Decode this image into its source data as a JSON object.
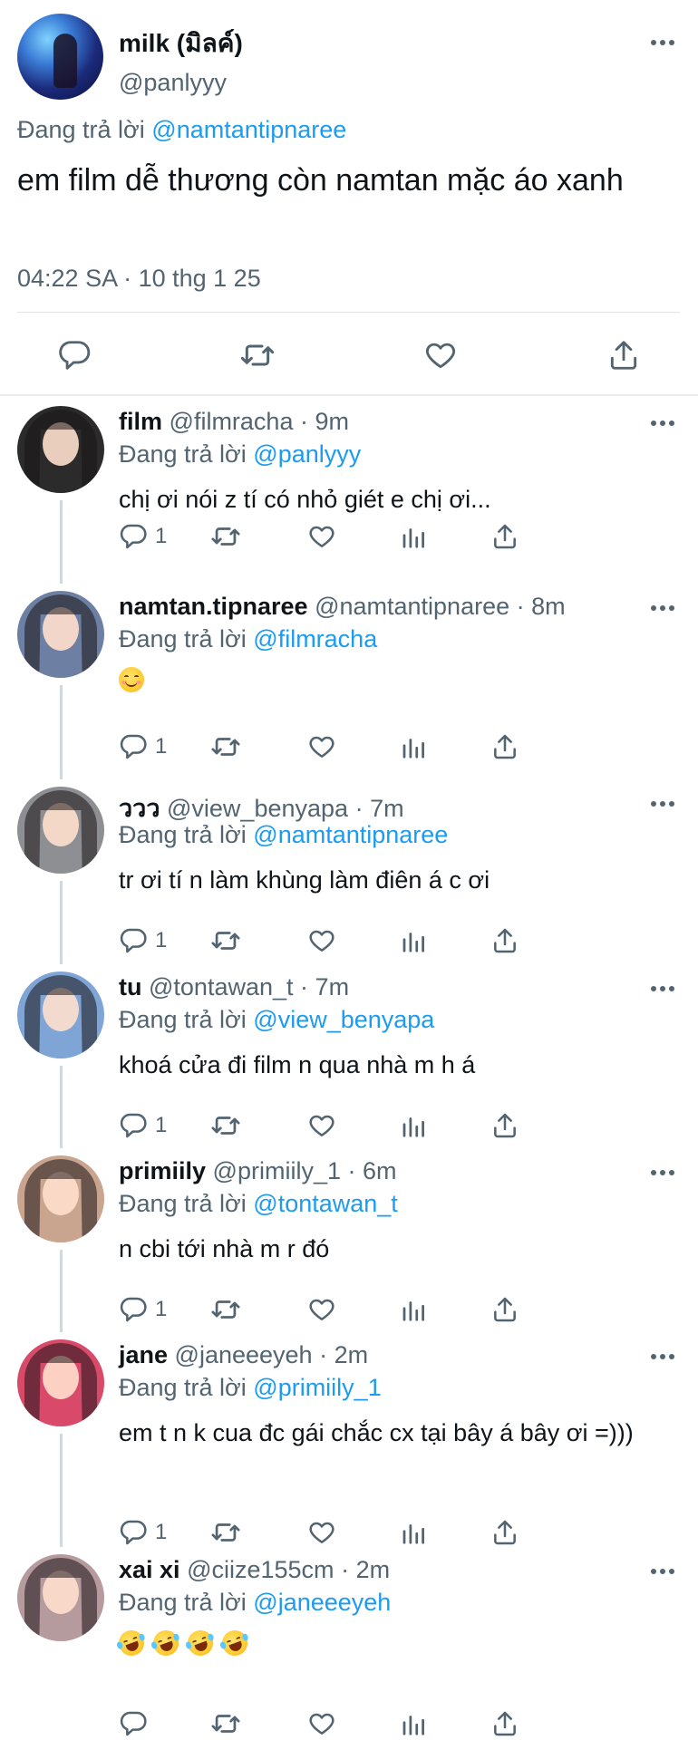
{
  "main": {
    "name": "milk (มิลค์)",
    "handle": "@panlyyy",
    "reply_prefix": "Đang trả lời",
    "reply_to": "@namtantipnaree",
    "text": "em film dễ thương còn namtan mặc áo xanh",
    "timestamp": "04:22 SA · 10 thg 1 25"
  },
  "replies": [
    {
      "name": "film",
      "handle": "@filmracha",
      "time": "9m",
      "reply_prefix": "Đang trả lời",
      "reply_to": "@panlyyy",
      "text": "chị ơi nói z tí có nhỏ giét e chị ơi...",
      "reply_count": "1",
      "avatar_color": "#2b2b2b"
    },
    {
      "name": "namtan.tipnaree",
      "handle": "@namtantipnaree",
      "time": "8m",
      "reply_prefix": "Đang trả lời",
      "reply_to": "@filmracha",
      "text": "",
      "emoji": "smiling-face-with-smiling-eyes",
      "reply_count": "1",
      "avatar_color": "#6d7fa3"
    },
    {
      "name": "ววว",
      "handle": "@view_benyapa",
      "time": "7m",
      "reply_prefix": "Đang trả lời",
      "reply_to": "@namtantipnaree",
      "text": "tr ơi tí n làm khùng làm điên á c ơi",
      "reply_count": "1",
      "avatar_color": "#8e8f93"
    },
    {
      "name": "tu",
      "handle": "@tontawan_t",
      "time": "7m",
      "reply_prefix": "Đang trả lời",
      "reply_to": "@view_benyapa",
      "text": "khoá cửa đi film n qua nhà m h á",
      "reply_count": "1",
      "avatar_color": "#7fa4d6"
    },
    {
      "name": "primiily",
      "handle": "@primiily_1",
      "time": "6m",
      "reply_prefix": "Đang trả lời",
      "reply_to": "@tontawan_t",
      "text": "n cbi tới nhà m r đó",
      "reply_count": "1",
      "avatar_color": "#c9a48f"
    },
    {
      "name": "jane",
      "handle": "@janeeeyeh",
      "time": "2m",
      "reply_prefix": "Đang trả lời",
      "reply_to": "@primiily_1",
      "text": "em t n k cua đc gái chắc cx tại bây á bây ơi =)))",
      "reply_count": "1",
      "avatar_color": "#d94a6a"
    },
    {
      "name": "xai xi",
      "handle": "@ciize155cm",
      "time": "2m",
      "reply_prefix": "Đang trả lời",
      "reply_to": "@janeeeyeh",
      "text": "",
      "emoji": "rolling-on-the-floor-laughing x4",
      "reply_count": "",
      "avatar_color": "#b59a9e"
    }
  ],
  "colors": {
    "accent": "#1d9bf0",
    "secondary_text": "#536471",
    "primary_text": "#0f1419",
    "thread_line": "#cfd9de",
    "icon": "#536471"
  },
  "icons": [
    "more-icon",
    "reply-icon",
    "retweet-icon",
    "like-icon",
    "views-icon",
    "share-icon"
  ]
}
